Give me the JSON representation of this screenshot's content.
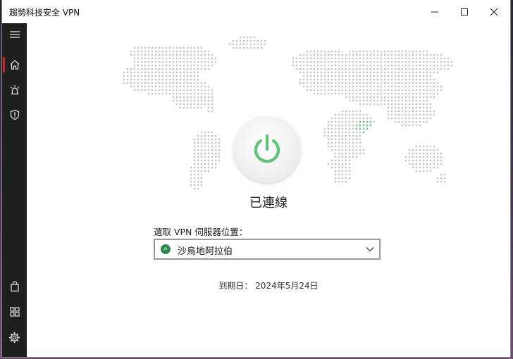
{
  "window": {
    "title": "趨勢科技安全 VPN"
  },
  "controls": {
    "minimize_icon": "minimize-icon",
    "maximize_icon": "maximize-icon",
    "close_icon": "close-icon"
  },
  "sidebar": {
    "items": [
      {
        "icon": "menu-icon",
        "active": false
      },
      {
        "icon": "home-icon",
        "active": true
      },
      {
        "icon": "alert-siren-icon",
        "active": false
      },
      {
        "icon": "shield-alert-icon",
        "active": false
      },
      {
        "icon": "shopping-bag-icon",
        "active": false
      },
      {
        "icon": "apps-grid-icon",
        "active": false
      },
      {
        "icon": "gear-icon",
        "active": false
      }
    ]
  },
  "main": {
    "status": "已連線",
    "location_label": "選取 VPN 伺服器位置：",
    "selected_location": "沙烏地阿拉伯",
    "expiry": "到期日： 2024年5月24日"
  },
  "colors": {
    "accent": "#d2222d",
    "connected_green": "#5cc57a",
    "sidebar_bg": "#1f1f1f",
    "map_dot": "#c7c7c7"
  }
}
